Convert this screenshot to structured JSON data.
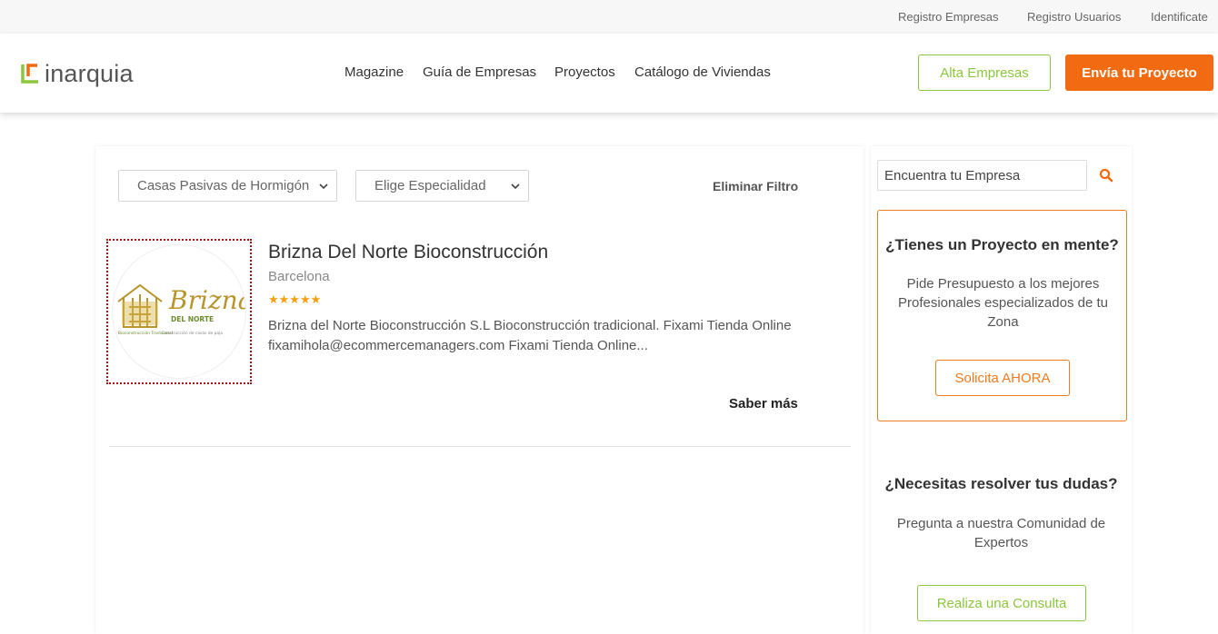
{
  "topbar": {
    "links": [
      "Registro Empresas",
      "Registro Usuarios",
      "Identificate"
    ]
  },
  "header": {
    "logo_text": "inarquia",
    "nav": [
      "Magazine",
      "Guía de Empresas",
      "Proyectos",
      "Catálogo de Viviendas"
    ],
    "alta_label": "Alta Empresas",
    "envia_label": "Envía tu Proyecto"
  },
  "filters": {
    "category_selected": "Casas Pasivas de Hormigón",
    "specialty_selected": "Elige Especialidad",
    "clear_label": "Eliminar Filtro"
  },
  "listing": {
    "logo_text": "Brizna",
    "logo_sub": "DEL NORTE",
    "logo_tag_left": "Bioconstrucción Tradicional",
    "logo_tag_right": "Construcción de casas de paja",
    "name": "Brizna Del Norte Bioconstrucción",
    "city": "Barcelona",
    "stars": "★★★★★",
    "rating": 5,
    "description": "Brizna del Norte Bioconstrucción S.L Bioconstrucción tradicional. Fixami Tienda Online fixamihola@ecommercemanagers.com Fixami Tienda Online...",
    "more_label": "Saber más"
  },
  "sidebar": {
    "search_placeholder": "Encuentra tu Empresa",
    "project_title": "¿Tienes un Proyecto en mente?",
    "project_text": "Pide Presupuesto a los mejores Profesionales especializados de tu Zona",
    "project_button": "Solicita AHORA",
    "doubts_title": "¿Necesitas resolver tus dudas?",
    "doubts_text": "Pregunta a nuestra Comunidad de Expertos",
    "doubts_button": "Realiza una Consulta"
  },
  "colors": {
    "brand_orange": "#f26b10",
    "brand_green": "#8cc63f",
    "logo_gold": "#b8942a"
  }
}
